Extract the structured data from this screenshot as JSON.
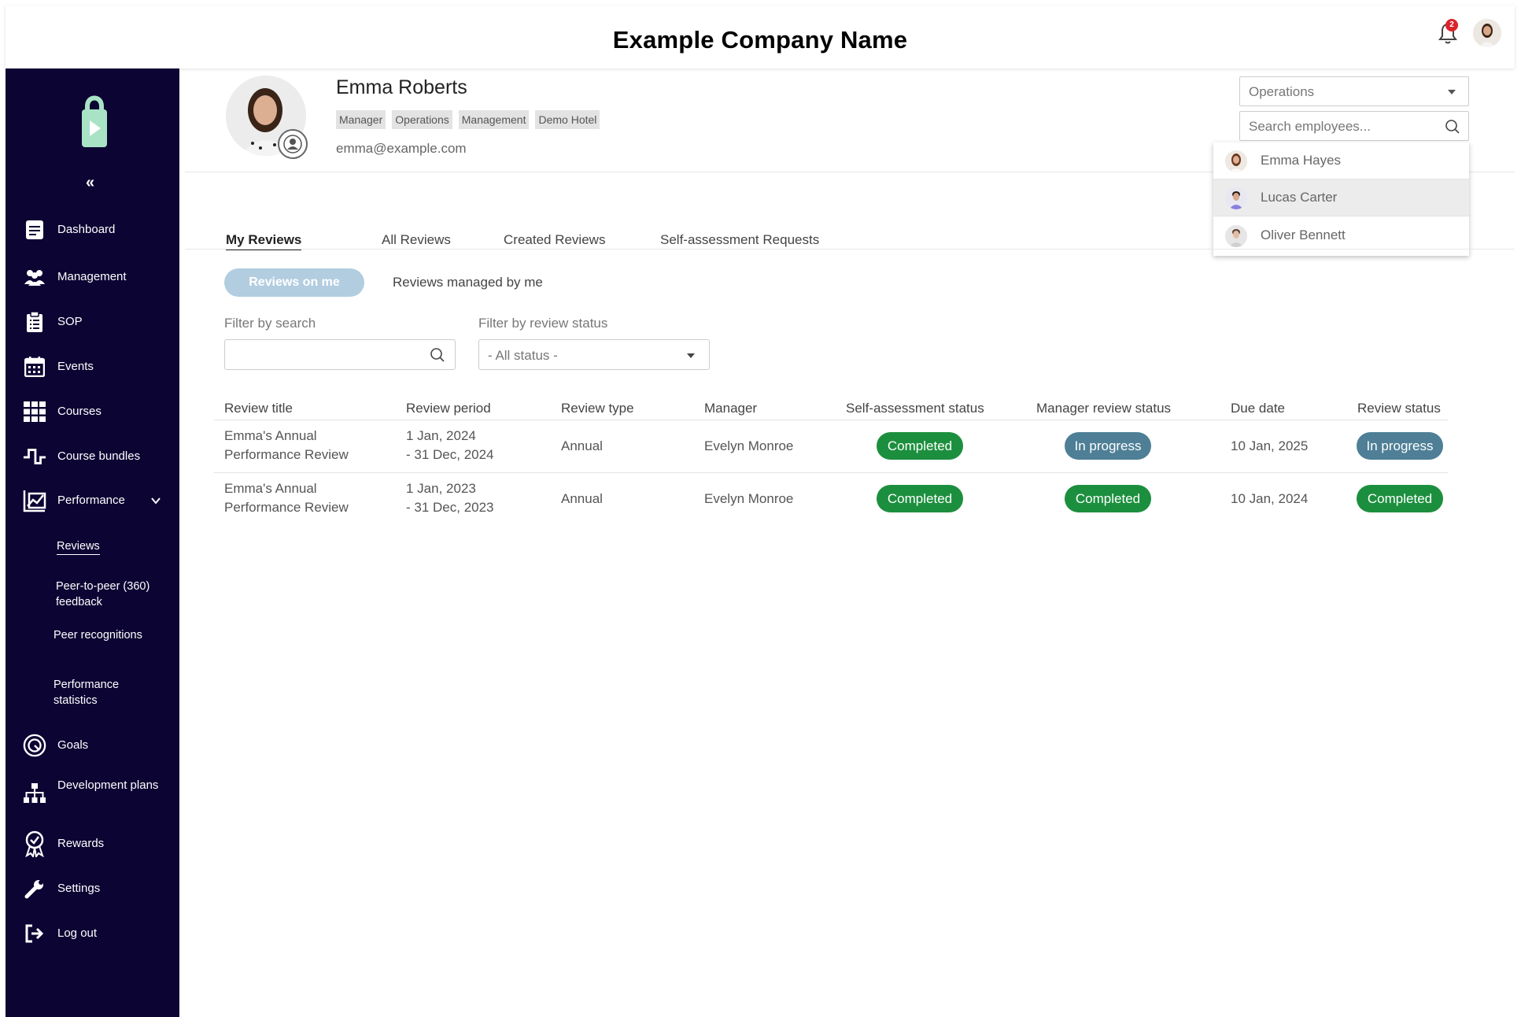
{
  "header": {
    "company_name": "Example Company Name",
    "notification_count": "2"
  },
  "sidebar": {
    "collapse_label": "«",
    "items": [
      {
        "label": "Dashboard",
        "icon": "dashboard-icon"
      },
      {
        "label": "Management",
        "icon": "people-icon"
      },
      {
        "label": "SOP",
        "icon": "clipboard-icon"
      },
      {
        "label": "Events",
        "icon": "calendar-icon"
      },
      {
        "label": "Courses",
        "icon": "grid-icon"
      },
      {
        "label": "Course bundles",
        "icon": "bundle-icon"
      },
      {
        "label": "Performance",
        "icon": "chart-icon"
      },
      {
        "label": "Goals",
        "icon": "target-icon"
      },
      {
        "label": "Development plans",
        "icon": "hierarchy-icon"
      },
      {
        "label": "Rewards",
        "icon": "award-icon"
      },
      {
        "label": "Settings",
        "icon": "wrench-icon"
      },
      {
        "label": "Log out",
        "icon": "logout-icon"
      }
    ],
    "performance_sub": [
      {
        "label": "Reviews"
      },
      {
        "label": "Peer-to-peer (360) feedback"
      },
      {
        "label": "Peer recognitions"
      },
      {
        "label": "Performance statistics"
      }
    ]
  },
  "profile": {
    "name": "Emma Roberts",
    "tags": [
      "Manager",
      "Operations",
      "Management",
      "Demo Hotel"
    ],
    "email": "emma@example.com"
  },
  "employee_picker": {
    "department": "Operations",
    "search_placeholder": "Search employees...",
    "results": [
      "Emma Hayes",
      "Lucas Carter",
      "Oliver Bennett"
    ]
  },
  "tabs": [
    "My Reviews",
    "All Reviews",
    "Created Reviews",
    "Self-assessment Requests"
  ],
  "subtabs": [
    "Reviews on me",
    "Reviews managed by me"
  ],
  "filters": {
    "search_label": "Filter by search",
    "status_label": "Filter by review status",
    "status_value": "- All status -"
  },
  "table": {
    "headers": [
      "Review title",
      "Review period",
      "Review type",
      "Manager",
      "Self-assessment status",
      "Manager review status",
      "Due date",
      "Review status"
    ],
    "rows": [
      {
        "title_line1": "Emma's Annual",
        "title_line2": "Performance Review",
        "period_line1": "1 Jan, 2024",
        "period_line2": "- 31 Dec, 2024",
        "type": "Annual",
        "manager": "Evelyn Monroe",
        "self_status": "Completed",
        "manager_status": "In progress",
        "due": "10 Jan, 2025",
        "review_status": "In progress"
      },
      {
        "title_line1": "Emma's Annual",
        "title_line2": "Performance Review",
        "period_line1": "1 Jan, 2023",
        "period_line2": "- 31 Dec, 2023",
        "type": "Annual",
        "manager": "Evelyn Monroe",
        "self_status": "Completed",
        "manager_status": "Completed",
        "due": "10 Jan, 2024",
        "review_status": "Completed"
      }
    ]
  },
  "colors": {
    "sidebar_bg": "#0c0433",
    "completed": "#1c8f3e",
    "in_progress": "#4e7f96",
    "pill": "#b2cde0",
    "logo": "#a8e3c6"
  }
}
